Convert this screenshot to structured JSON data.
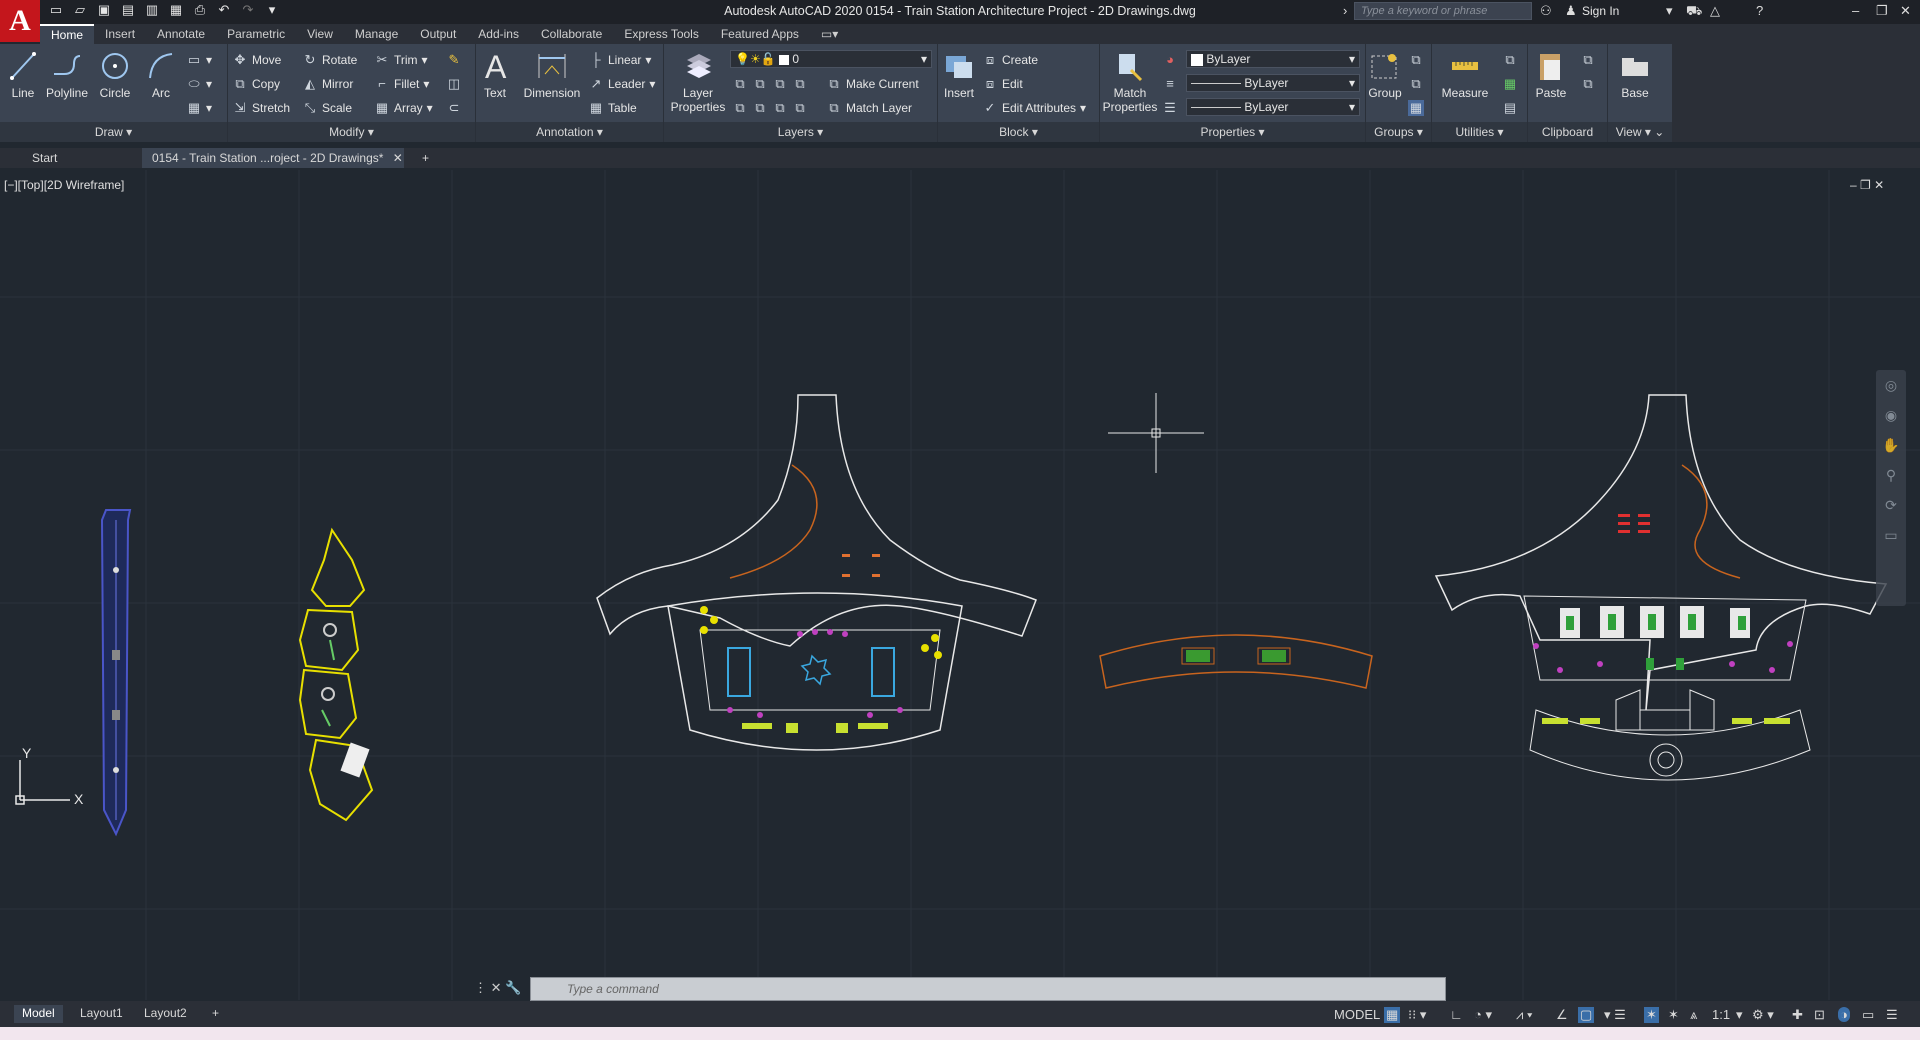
{
  "app": {
    "logo_letter": "A",
    "title": "Autodesk AutoCAD 2020    0154 - Train Station Architecture Project - 2D Drawings.dwg",
    "search_placeholder": "Type a keyword or phrase",
    "sign_in": "Sign In"
  },
  "ribbon_tabs": [
    "Home",
    "Insert",
    "Annotate",
    "Parametric",
    "View",
    "Manage",
    "Output",
    "Add-ins",
    "Collaborate",
    "Express Tools",
    "Featured Apps"
  ],
  "draw": {
    "title": "Draw",
    "line": "Line",
    "polyline": "Polyline",
    "circle": "Circle",
    "arc": "Arc"
  },
  "modify": {
    "title": "Modify",
    "move": "Move",
    "rotate": "Rotate",
    "trim": "Trim",
    "copy": "Copy",
    "mirror": "Mirror",
    "fillet": "Fillet",
    "stretch": "Stretch",
    "scale": "Scale",
    "array": "Array"
  },
  "annotation": {
    "title": "Annotation",
    "text": "Text",
    "dimension": "Dimension",
    "linear": "Linear",
    "leader": "Leader",
    "table": "Table"
  },
  "layers": {
    "title": "Layers",
    "layer_properties": "Layer Properties",
    "current_layer": "0",
    "make_current": "Make Current",
    "match_layer": "Match Layer"
  },
  "block": {
    "title": "Block",
    "insert": "Insert",
    "create": "Create",
    "edit": "Edit",
    "edit_attributes": "Edit Attributes"
  },
  "properties": {
    "title": "Properties",
    "match_properties": "Match Properties",
    "color": "ByLayer",
    "linetype": "ByLayer",
    "lineweight": "ByLayer"
  },
  "groups": {
    "title": "Groups",
    "group": "Group"
  },
  "utilities": {
    "title": "Utilities",
    "measure": "Measure"
  },
  "clipboard": {
    "title": "Clipboard",
    "paste": "Paste"
  },
  "view": {
    "title": "View",
    "base": "Base"
  },
  "doc_tabs": {
    "start": "Start",
    "active": "0154 - Train Station ...roject - 2D Drawings*"
  },
  "viewport_label": "[−][Top][2D Wireframe]",
  "ucs": {
    "x": "X",
    "y": "Y"
  },
  "command_placeholder": "Type  a  command",
  "layout_tabs": [
    "Model",
    "Layout1",
    "Layout2"
  ],
  "status": {
    "model": "MODEL",
    "scale": "1:1"
  },
  "colors": {
    "background": "#212830",
    "ribbon": "#3b4452",
    "accent": "#c4161c",
    "yellow": "#e8e000",
    "blue": "#4a55c8",
    "orange": "#c8641e",
    "white": "#f0f0f0"
  }
}
